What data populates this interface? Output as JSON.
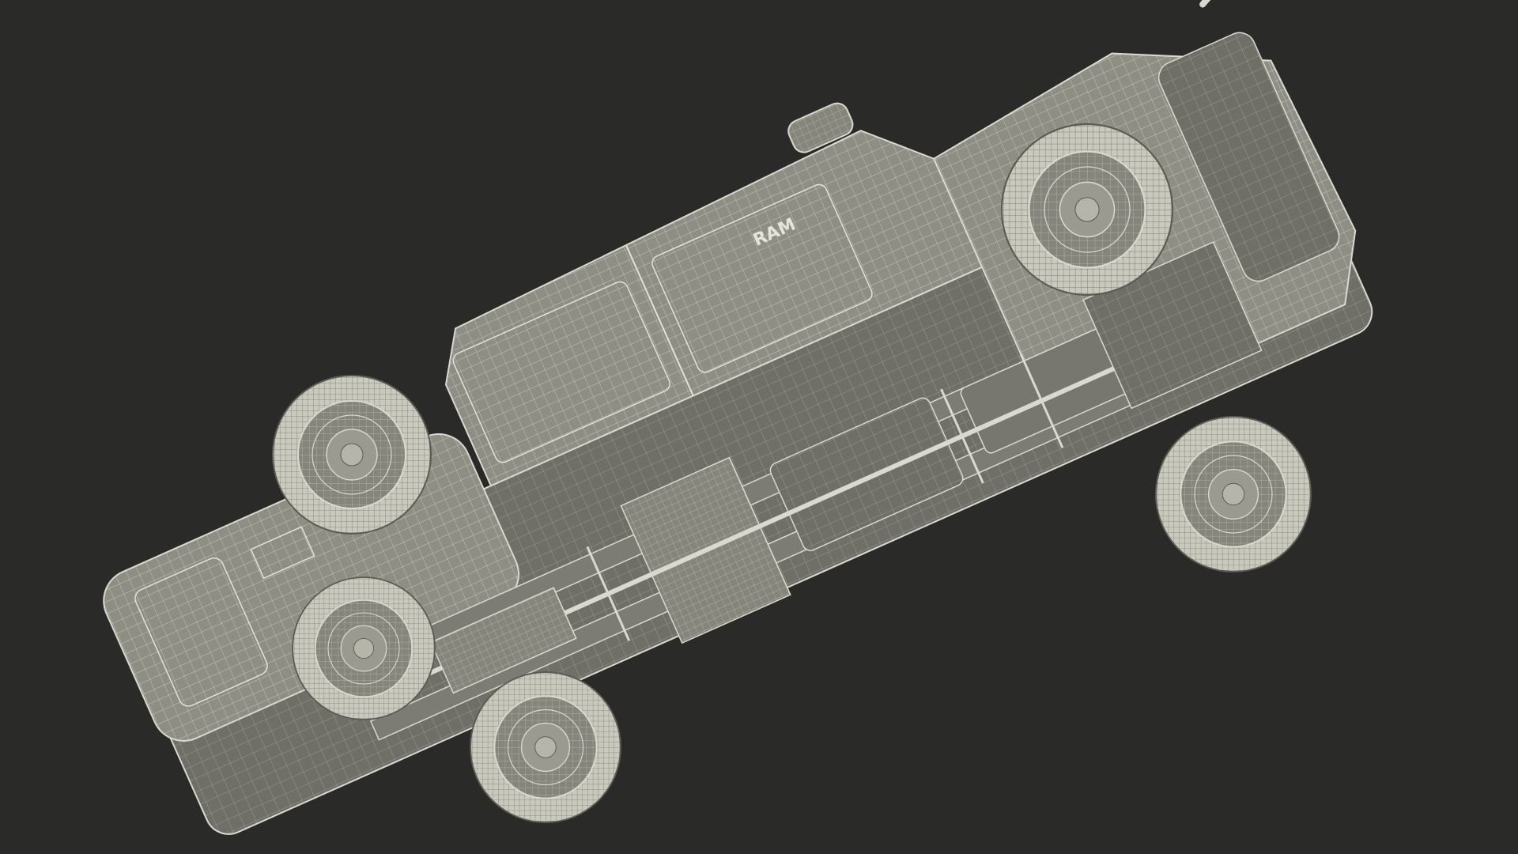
{
  "scene": {
    "subject": "pickup-truck-underside-wireframe",
    "colors": {
      "background": "#2a2a28",
      "body_fill": "#8e8e85",
      "body_shade": "#6f6f68",
      "wire": "#d9d9cf",
      "tire": "#c9c9bd",
      "dark": "#4e4e49"
    }
  },
  "badges": {
    "door_logo": "RAM"
  }
}
